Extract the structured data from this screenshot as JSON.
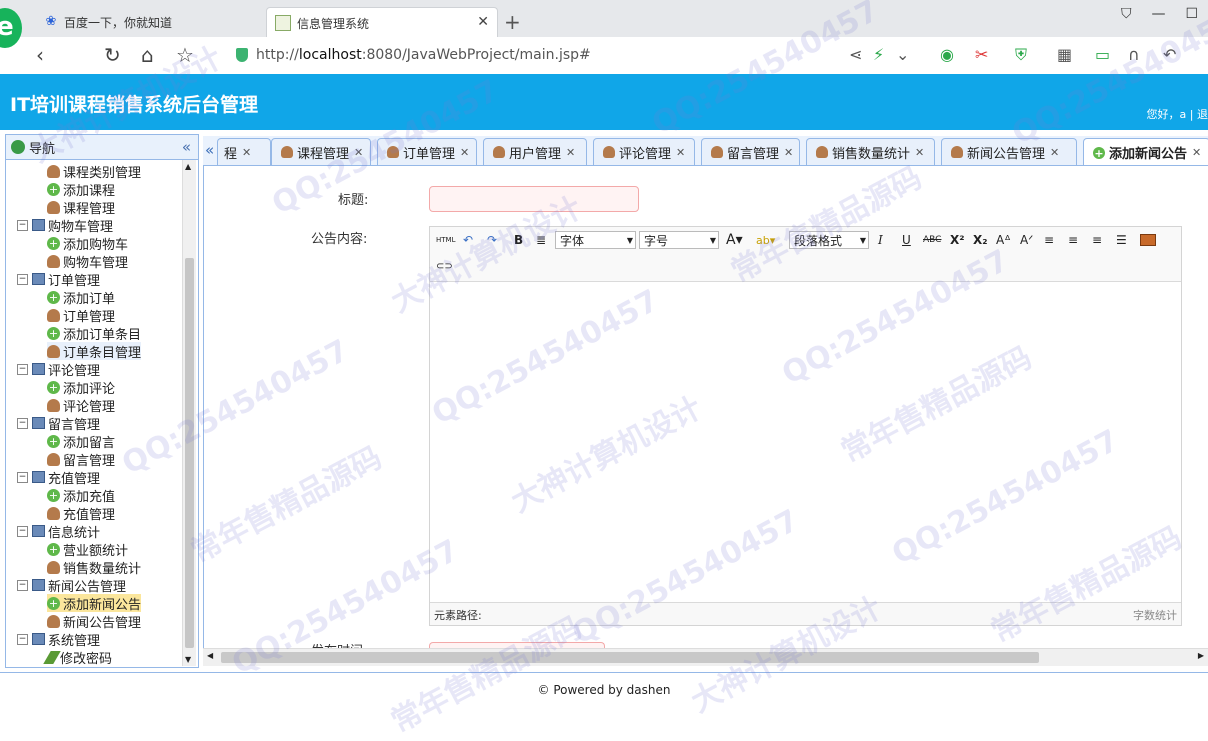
{
  "browser": {
    "tabs": [
      {
        "title": "百度一下，你就知道"
      },
      {
        "title": "信息管理系统"
      }
    ],
    "url_prefix": "http://",
    "url_host": "localhost",
    "url_rest": ":8080/JavaWebProject/main.jsp#"
  },
  "header": {
    "title": "IT培训课程销售系统后台管理",
    "greeting": "您好，a | 退"
  },
  "nav": {
    "title": "导航",
    "tree": [
      {
        "label": "课程类别管理",
        "level": 1,
        "icon": "user"
      },
      {
        "label": "添加课程",
        "level": 1,
        "icon": "add"
      },
      {
        "label": "课程管理",
        "level": 1,
        "icon": "user"
      },
      {
        "label": "购物车管理",
        "level": 0,
        "icon": "pc"
      },
      {
        "label": "添加购物车",
        "level": 1,
        "icon": "add"
      },
      {
        "label": "购物车管理",
        "level": 1,
        "icon": "user"
      },
      {
        "label": "订单管理",
        "level": 0,
        "icon": "pc"
      },
      {
        "label": "添加订单",
        "level": 1,
        "icon": "add"
      },
      {
        "label": "订单管理",
        "level": 1,
        "icon": "user"
      },
      {
        "label": "添加订单条目",
        "level": 1,
        "icon": "add"
      },
      {
        "label": "订单条目管理",
        "level": 1,
        "icon": "user",
        "hover": true
      },
      {
        "label": "评论管理",
        "level": 0,
        "icon": "pc"
      },
      {
        "label": "添加评论",
        "level": 1,
        "icon": "add"
      },
      {
        "label": "评论管理",
        "level": 1,
        "icon": "user"
      },
      {
        "label": "留言管理",
        "level": 0,
        "icon": "pc"
      },
      {
        "label": "添加留言",
        "level": 1,
        "icon": "add"
      },
      {
        "label": "留言管理",
        "level": 1,
        "icon": "user"
      },
      {
        "label": "充值管理",
        "level": 0,
        "icon": "pc"
      },
      {
        "label": "添加充值",
        "level": 1,
        "icon": "add"
      },
      {
        "label": "充值管理",
        "level": 1,
        "icon": "user"
      },
      {
        "label": "信息统计",
        "level": 0,
        "icon": "pc"
      },
      {
        "label": "营业额统计",
        "level": 1,
        "icon": "add"
      },
      {
        "label": "销售数量统计",
        "level": 1,
        "icon": "user"
      },
      {
        "label": "新闻公告管理",
        "level": 0,
        "icon": "pc"
      },
      {
        "label": "添加新闻公告",
        "level": 1,
        "icon": "add",
        "selected": true
      },
      {
        "label": "新闻公告管理",
        "level": 1,
        "icon": "user"
      },
      {
        "label": "系统管理",
        "level": 0,
        "icon": "pc"
      },
      {
        "label": "修改密码",
        "level": 1,
        "icon": "pen"
      }
    ]
  },
  "tabs": [
    {
      "label": "程",
      "icon": "none"
    },
    {
      "label": "课程管理",
      "icon": "user"
    },
    {
      "label": "订单管理",
      "icon": "user"
    },
    {
      "label": "用户管理",
      "icon": "user"
    },
    {
      "label": "评论管理",
      "icon": "user"
    },
    {
      "label": "留言管理",
      "icon": "user"
    },
    {
      "label": "销售数量统计",
      "icon": "user"
    },
    {
      "label": "新闻公告管理",
      "icon": "user"
    },
    {
      "label": "添加新闻公告",
      "icon": "add",
      "active": true
    }
  ],
  "form": {
    "title_label": "标题:",
    "content_label": "公告内容:",
    "date_label": "发布时间:",
    "title_value": ""
  },
  "editor": {
    "font_family": "字体",
    "font_size": "字号",
    "paragraph": "段落格式",
    "status_left": "元素路径:",
    "status_right": "字数统计"
  },
  "footer": {
    "text": "© Powered by dashen"
  },
  "watermark": {
    "a": "QQ:254540457",
    "b": "大神计算机设计",
    "c": "常年售精品源码"
  }
}
